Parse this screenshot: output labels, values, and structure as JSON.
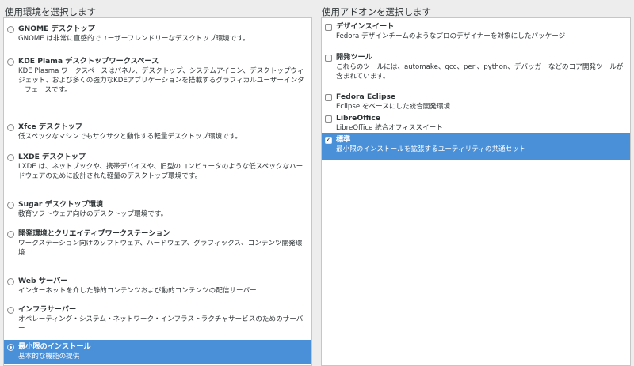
{
  "environment": {
    "heading": "使用環境を選択します",
    "items": [
      {
        "title": "GNOME デスクトップ",
        "desc": "GNOME は非常に直感的でユーザーフレンドリーなデスクトップ環境です。",
        "selected": false
      },
      {
        "title": "KDE Plama デスクトップワークスペース",
        "desc": "KDE Plasma ワークスペースはパネル、デスクトップ、システムアイコン、デスクトップウィジェット、および多くの強力なKDEアプリケーションを搭載するグラフィカルユーザーインターフェースです。",
        "selected": false
      },
      {
        "title": "Xfce デスクトップ",
        "desc": "低スペックなマシンでもサクサクと動作する軽量デスクトップ環境です。",
        "selected": false
      },
      {
        "title": "LXDE デスクトップ",
        "desc": "LXDE は、ネットブックや、携帯デバイスや、旧型のコンピュータのような低スペックなハードウェアのために設計された軽量のデスクトップ環境です。",
        "selected": false
      },
      {
        "title": "Sugar デスクトップ環境",
        "desc": "教育ソフトウェア向けのデスクトップ環境です。",
        "selected": false
      },
      {
        "title": "開発環境とクリエイティブワークステーション",
        "desc": "ワークステーション向けのソフトウェア、ハードウェア、グラフィックス、コンテンツ開発環境",
        "selected": false
      },
      {
        "title": "Web サーバー",
        "desc": "インターネットを介した静的コンテンツおよび動的コンテンツの配信サーバー",
        "selected": false
      },
      {
        "title": "インフラサーバー",
        "desc": "オペレーティング・システム・ネットワーク・インフラストラクチャサービスのためのサーバー",
        "selected": false
      },
      {
        "title": "最小限のインストール",
        "desc": "基本的な機能の提供",
        "selected": true
      }
    ]
  },
  "addons": {
    "heading": "使用アドオンを選択します",
    "items": [
      {
        "title": "デザインスイート",
        "desc": "Fedora デザインチームのようなプロのデザイナーを対象にしたパッケージ",
        "checked": false,
        "selected": false
      },
      {
        "title": "開発ツール",
        "desc": "これらのツールには、automake、gcc、perl、python、デバッガーなどのコア開発ツールが含まれています。",
        "checked": false,
        "selected": false
      },
      {
        "title": "Fedora Eclipse",
        "desc": "Eclipse をベースにした統合開発環境",
        "checked": false,
        "selected": false
      },
      {
        "title": "LibreOffice",
        "desc": "LibreOffice 統合オフィススイート",
        "checked": false,
        "selected": false
      },
      {
        "title": "標準",
        "desc": "最小限のインストールを拡張するユーティリティの共通セット",
        "checked": true,
        "checkmark": "✓",
        "selected": true
      }
    ]
  }
}
